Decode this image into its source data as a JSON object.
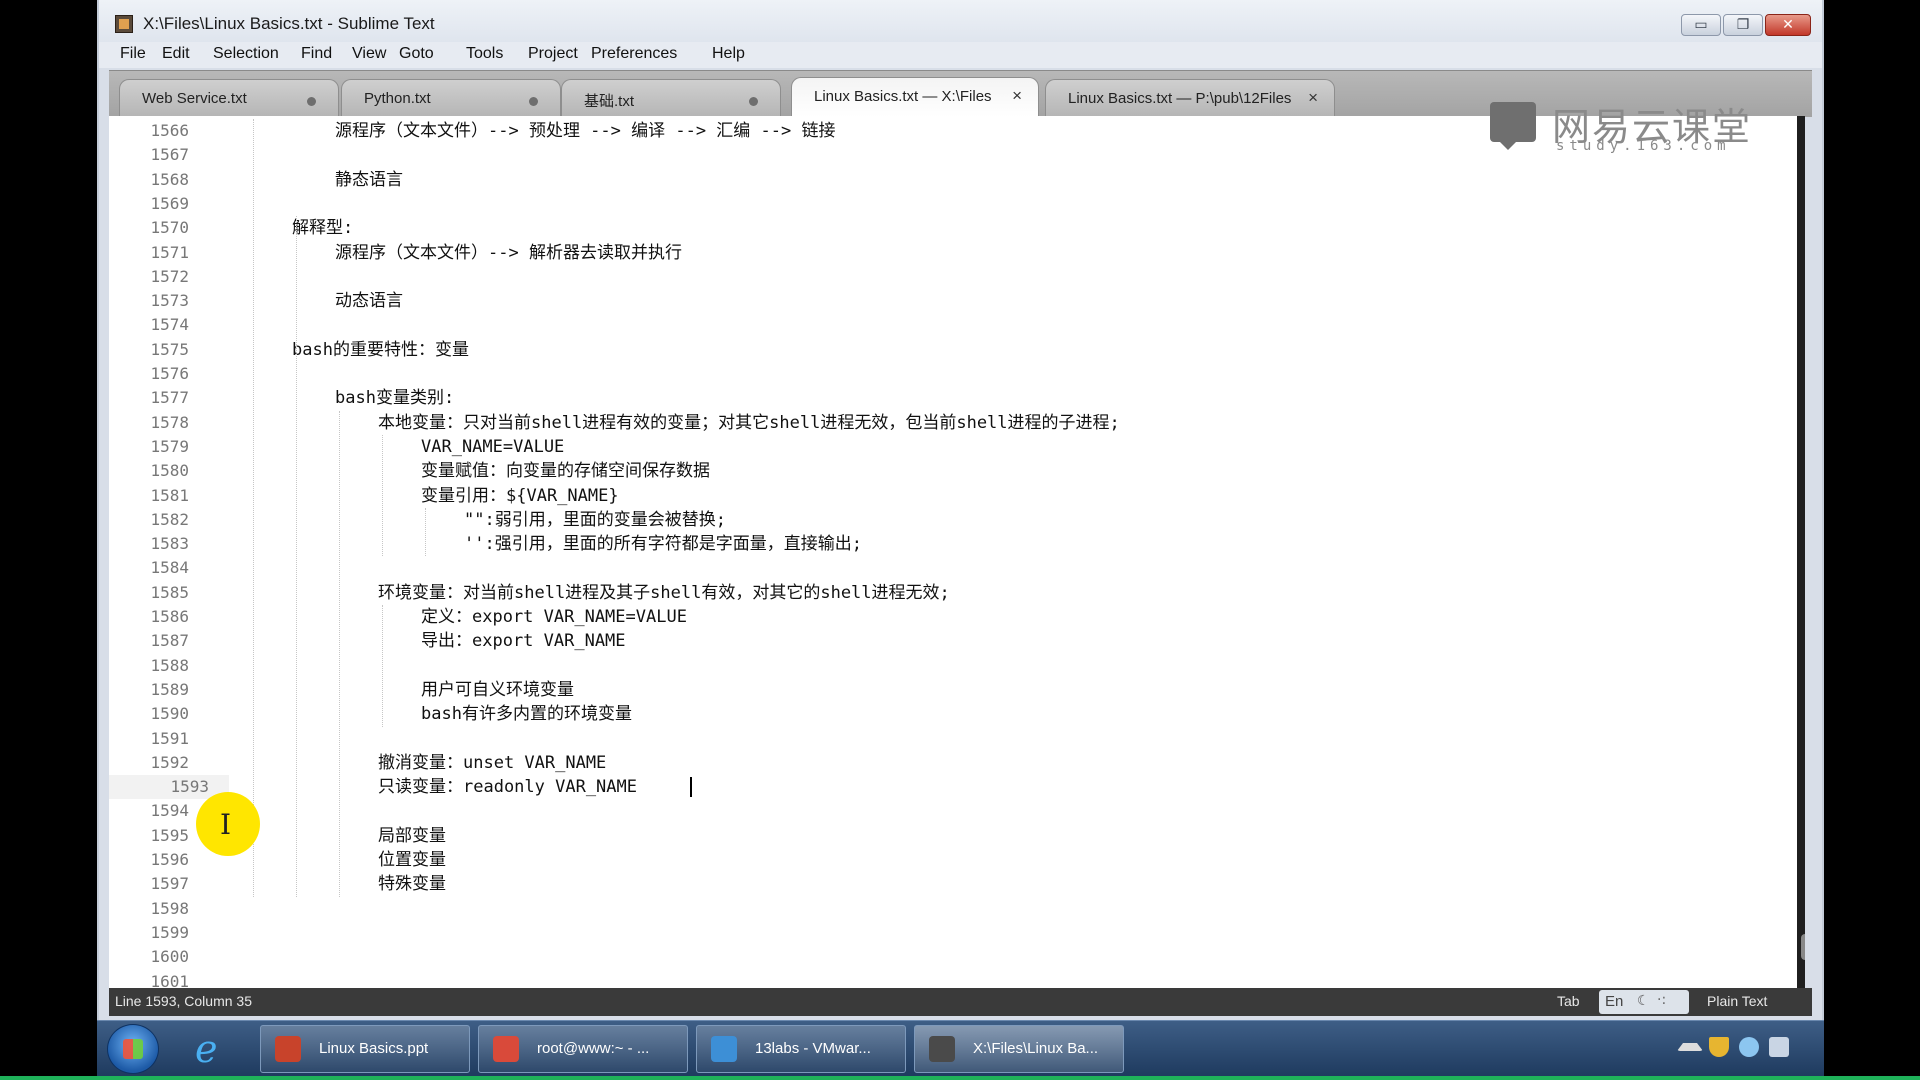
{
  "window": {
    "title": "X:\\Files\\Linux Basics.txt - Sublime Text",
    "minimize_glyph": "▭",
    "maximize_glyph": "❐",
    "close_glyph": "✕"
  },
  "menu": [
    "File",
    "Edit",
    "Selection",
    "Find",
    "View",
    "Goto",
    "Tools",
    "Project",
    "Preferences",
    "Help"
  ],
  "tabs": [
    {
      "label": "Web Service.txt",
      "dirty": true,
      "active": false
    },
    {
      "label": "Python.txt",
      "dirty": true,
      "active": false
    },
    {
      "label": "基础.txt",
      "dirty": true,
      "active": false
    },
    {
      "label": "Linux Basics.txt — X:\\Files",
      "dirty": false,
      "active": true,
      "close_glyph": "×"
    },
    {
      "label": "Linux Basics.txt — P:\\pub\\12Files",
      "dirty": false,
      "active": false,
      "close_glyph": "×"
    }
  ],
  "editor": {
    "current_line": 1593,
    "lines": [
      {
        "n": "1566",
        "indent": 2,
        "text": "源程序（文本文件）--> 预处理 --> 编译 --> 汇编 --> 链接"
      },
      {
        "n": "1567",
        "indent": 0,
        "text": ""
      },
      {
        "n": "1568",
        "indent": 2,
        "text": "静态语言"
      },
      {
        "n": "1569",
        "indent": 0,
        "text": ""
      },
      {
        "n": "1570",
        "indent": 1,
        "text": "解释型:"
      },
      {
        "n": "1571",
        "indent": 2,
        "text": "源程序（文本文件）--> 解析器去读取并执行"
      },
      {
        "n": "1572",
        "indent": 0,
        "text": ""
      },
      {
        "n": "1573",
        "indent": 2,
        "text": "动态语言"
      },
      {
        "n": "1574",
        "indent": 0,
        "text": ""
      },
      {
        "n": "1575",
        "indent": 1,
        "text": "bash的重要特性：变量"
      },
      {
        "n": "1576",
        "indent": 0,
        "text": ""
      },
      {
        "n": "1577",
        "indent": 2,
        "text": "bash变量类别:"
      },
      {
        "n": "1578",
        "indent": 3,
        "text": "本地变量：只对当前shell进程有效的变量；对其它shell进程无效，包当前shell进程的子进程;"
      },
      {
        "n": "1579",
        "indent": 4,
        "text": "VAR_NAME=VALUE"
      },
      {
        "n": "1580",
        "indent": 4,
        "text": "变量赋值：向变量的存储空间保存数据"
      },
      {
        "n": "1581",
        "indent": 4,
        "text": "变量引用：${VAR_NAME}"
      },
      {
        "n": "1582",
        "indent": 5,
        "text": "\"\":弱引用，里面的变量会被替换;"
      },
      {
        "n": "1583",
        "indent": 5,
        "text": "'':强引用，里面的所有字符都是字面量，直接输出;"
      },
      {
        "n": "1584",
        "indent": 0,
        "text": ""
      },
      {
        "n": "1585",
        "indent": 3,
        "text": "环境变量：对当前shell进程及其子shell有效，对其它的shell进程无效;"
      },
      {
        "n": "1586",
        "indent": 4,
        "text": "定义：export VAR_NAME=VALUE"
      },
      {
        "n": "1587",
        "indent": 4,
        "text": "导出：export VAR_NAME"
      },
      {
        "n": "1588",
        "indent": 0,
        "text": ""
      },
      {
        "n": "1589",
        "indent": 4,
        "text": "用户可自义环境变量"
      },
      {
        "n": "1590",
        "indent": 4,
        "text": "bash有许多内置的环境变量"
      },
      {
        "n": "1591",
        "indent": 0,
        "text": ""
      },
      {
        "n": "1592",
        "indent": 3,
        "text": "撤消变量：unset VAR_NAME"
      },
      {
        "n": "1593",
        "indent": 3,
        "text": "只读变量：readonly VAR_NAME"
      },
      {
        "n": "1594",
        "indent": 0,
        "text": ""
      },
      {
        "n": "1595",
        "indent": 3,
        "text": "局部变量"
      },
      {
        "n": "1596",
        "indent": 3,
        "text": "位置变量"
      },
      {
        "n": "1597",
        "indent": 3,
        "text": "特殊变量"
      },
      {
        "n": "1598",
        "indent": 0,
        "text": ""
      },
      {
        "n": "1599",
        "indent": 0,
        "text": ""
      },
      {
        "n": "1600",
        "indent": 0,
        "text": ""
      },
      {
        "n": "1601",
        "indent": 0,
        "text": ""
      }
    ]
  },
  "watermark": {
    "name": "网易云课堂",
    "url": "study.163.com"
  },
  "cursor_glyph": "I",
  "status": {
    "position": "Line 1593, Column 35",
    "indent": "Tab",
    "ime_label": "En",
    "ime_moon": "☾",
    "ime_dots": "·:",
    "syntax": "Plain Text"
  },
  "taskbar": {
    "ie_glyph": "e",
    "tasks": [
      {
        "label": "Linux Basics.ppt",
        "icon": "powerpoint-icon",
        "color": "#c8432b",
        "active": false
      },
      {
        "label": "root@www:~ - ...",
        "icon": "terminal-icon",
        "color": "#d94a3a",
        "active": false
      },
      {
        "label": "13labs - VMwar...",
        "icon": "vmware-icon",
        "color": "#3d8fd6",
        "active": false
      },
      {
        "label": "X:\\Files\\Linux Ba...",
        "icon": "sublime-icon",
        "color": "#4a4a4a",
        "active": true
      }
    ]
  },
  "colors": {
    "accent_blue": "#1e3a5e",
    "editor_bg": "#ffffff",
    "status_bg": "#3a3a3a",
    "highlight_yellow": "#ffe600"
  }
}
